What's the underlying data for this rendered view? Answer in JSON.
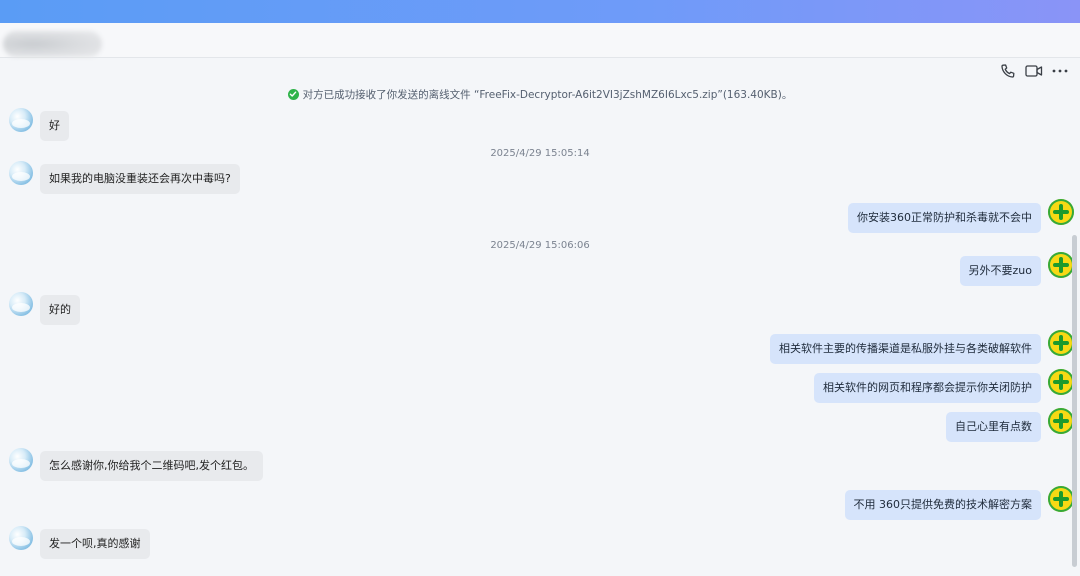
{
  "toolbar": {
    "phone_icon": "phone-icon",
    "video_icon": "video-camera-icon",
    "more_icon": "more-options-icon"
  },
  "notice": {
    "text": "对方已成功接收了你发送的离线文件 “FreeFix-Decryptor-A6it2VI3jZshMZ6I6Lxc5.zip”(163.40KB)。",
    "status_color": "#2fb34a"
  },
  "messages": [
    {
      "side": "in",
      "text": "好"
    },
    {
      "type": "time",
      "text": "2025/4/29 15:05:14"
    },
    {
      "side": "in",
      "text": "如果我的电脑没重装还会再次中毒吗?"
    },
    {
      "side": "out",
      "text": "你安装360正常防护和杀毒就不会中"
    },
    {
      "type": "time",
      "text": "2025/4/29 15:06:06"
    },
    {
      "side": "out",
      "text": "另外不要zuo"
    },
    {
      "side": "in",
      "text": "好的"
    },
    {
      "side": "out",
      "text": "相关软件主要的传播渠道是私服外挂与各类破解软件"
    },
    {
      "side": "out",
      "text": "相关软件的网页和程序都会提示你关闭防护"
    },
    {
      "side": "out",
      "text": "自己心里有点数"
    },
    {
      "side": "in",
      "text": "怎么感谢你,你给我个二维码吧,发个红包。"
    },
    {
      "side": "out",
      "text": "不用 360只提供免费的技术解密方案"
    },
    {
      "side": "in",
      "text": "发一个呗,真的感谢"
    }
  ],
  "colors": {
    "header_gradient_start": "#5a9cf5",
    "outgoing_bubble": "#d6e4fb",
    "incoming_bubble": "#e8eaed"
  }
}
